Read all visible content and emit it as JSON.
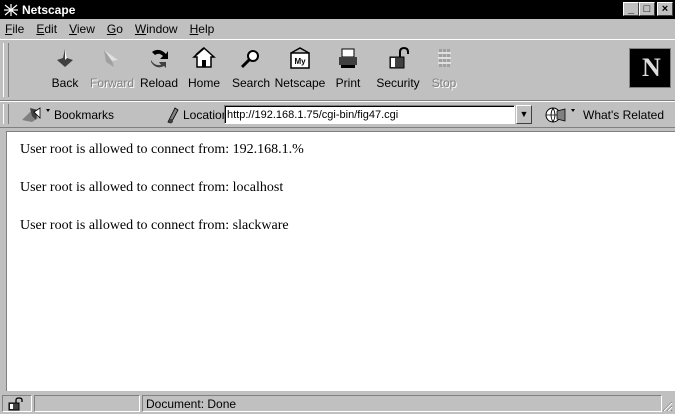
{
  "window": {
    "title": "Netscape",
    "minimize": "_",
    "maximize": "□",
    "close": "×"
  },
  "menu": [
    {
      "key": "F",
      "rest": "ile"
    },
    {
      "key": "E",
      "rest": "dit"
    },
    {
      "key": "V",
      "rest": "iew"
    },
    {
      "key": "G",
      "rest": "o"
    },
    {
      "key": "W",
      "rest": "indow"
    },
    {
      "key": "H",
      "rest": "elp"
    }
  ],
  "toolbar": {
    "back": "Back",
    "forward": "Forward",
    "reload": "Reload",
    "home": "Home",
    "search": "Search",
    "netscape": "Netscape",
    "print": "Print",
    "security": "Security",
    "stop": "Stop",
    "logo": "N"
  },
  "location": {
    "bookmarks_label": "Bookmarks",
    "location_label": "Location:",
    "url": "http://192.168.1.75/cgi-bin/fig47.cgi",
    "whats_related": "What's Related"
  },
  "content": {
    "lines": [
      "User root is allowed to connect from: 192.168.1.%",
      "User root is allowed to connect from: localhost",
      "User root is allowed to connect from: slackware"
    ]
  },
  "status": {
    "text": "Document: Done"
  }
}
